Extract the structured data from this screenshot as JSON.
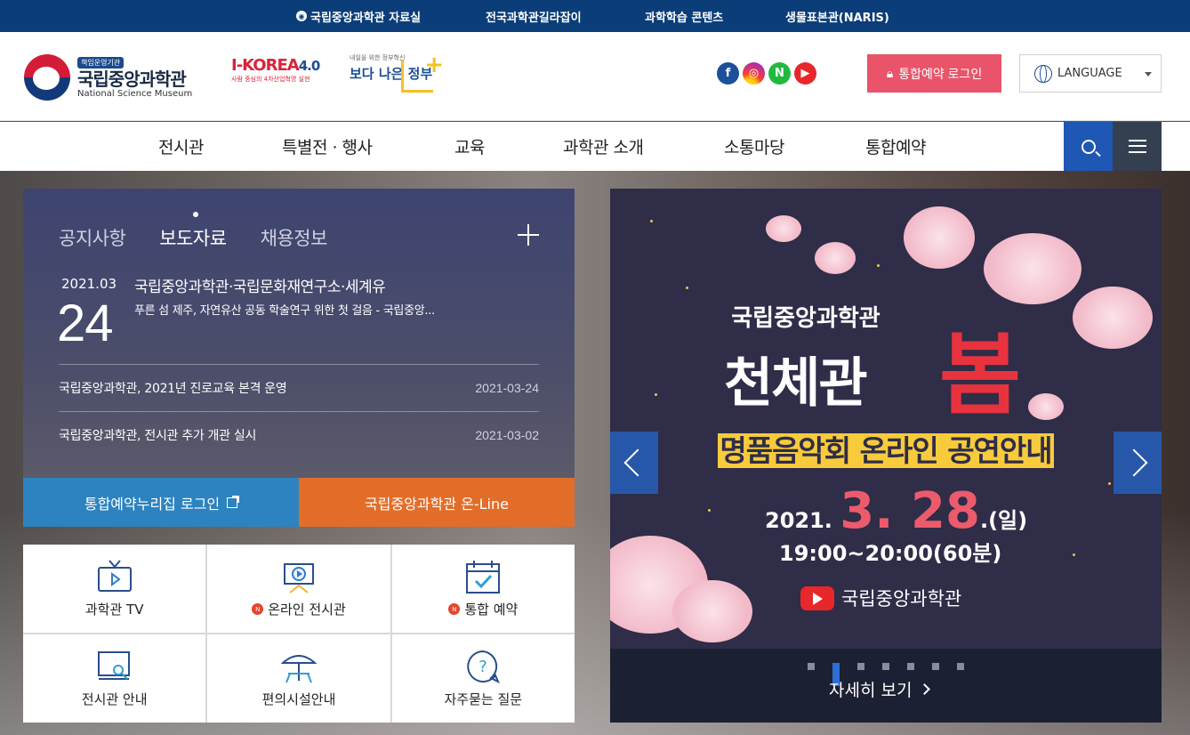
{
  "topbar": {
    "links": [
      "국립중앙과학관 자료실",
      "전국과학관길라잡이",
      "과학학습 콘텐츠",
      "생물표본관(NARIS)"
    ]
  },
  "header": {
    "logo_badge": "책임운영기관",
    "logo_ko": "국립중앙과학관",
    "logo_en": "National Science Museum",
    "ikorea_title": "I-KOREA",
    "ikorea_version": "4.0",
    "ikorea_sub": "사람 중심의 4차산업혁명 실현",
    "better_sub": "내일을 위한 정부혁신",
    "better_title": "보다 나은 정부",
    "social": [
      "facebook-icon",
      "instagram-icon",
      "naver-icon",
      "youtube-icon"
    ],
    "login_label": "통합예약 로그인",
    "language_label": "LANGUAGE"
  },
  "nav": {
    "items": [
      "전시관",
      "특별전 · 행사",
      "교육",
      "과학관 소개",
      "소통마당",
      "통합예약"
    ]
  },
  "notice": {
    "tabs": [
      "공지사항",
      "보도자료",
      "채용정보"
    ],
    "active_tab": "보도자료",
    "featured": {
      "year_month": "2021.03",
      "day": "24",
      "title": "국립중앙과학관·국립문화재연구소·세계유",
      "desc": "푸른 섬 제주, 자연유산 공동 학술연구 위한 첫 걸음 - 국립중앙..."
    },
    "rows": [
      {
        "title": "국립중앙과학관, 2021년 진로교육 본격 운영",
        "date": "2021-03-24"
      },
      {
        "title": "국립중앙과학관, 전시관 추가 개관 실시",
        "date": "2021-03-02"
      }
    ]
  },
  "quick": {
    "left_label": "통합예약누리집 로그인",
    "right_label": "국립중앙과학관 온-Line"
  },
  "grid": {
    "items": [
      {
        "label": "과학관 TV",
        "icon": "tv-icon",
        "badge": ""
      },
      {
        "label": "온라인 전시관",
        "icon": "online-exhibit-icon",
        "badge": "N"
      },
      {
        "label": "통합 예약",
        "icon": "calendar-check-icon",
        "badge": "N"
      },
      {
        "label": "전시관 안내",
        "icon": "monitor-search-icon",
        "badge": ""
      },
      {
        "label": "편의시설안내",
        "icon": "umbrella-table-icon",
        "badge": ""
      },
      {
        "label": "자주묻는 질문",
        "icon": "question-bubble-icon",
        "badge": ""
      }
    ]
  },
  "banner": {
    "line1": "국립중앙과학관",
    "line2": "천체관",
    "line2_accent": "봄",
    "line3": "명품음악회 온라인 공연안내",
    "date_prefix": "2021.",
    "date_big": "3. 28",
    "date_suffix": ".(일)",
    "time": "19:00~20:00(60분)",
    "channel": "국립중앙과학관",
    "more_label": "자세히 보기",
    "slide_count": 7,
    "active_slide": 2
  },
  "colors": {
    "topbar": "#0b3d78",
    "login": "#e9546b",
    "search": "#1f57b4",
    "quick_left": "#2c83bf",
    "quick_right": "#e26d28"
  }
}
